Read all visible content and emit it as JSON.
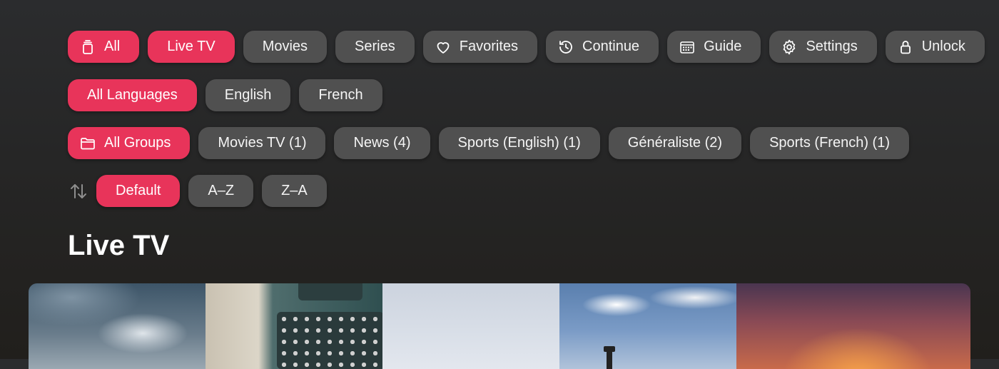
{
  "filters": {
    "type": [
      {
        "label": "All",
        "icon": "trash-icon",
        "active": true
      },
      {
        "label": "Live TV",
        "icon": "",
        "active": true
      },
      {
        "label": "Movies",
        "icon": "",
        "active": false
      },
      {
        "label": "Series",
        "icon": "",
        "active": false
      },
      {
        "label": "Favorites",
        "icon": "heart-icon",
        "active": false
      },
      {
        "label": "Continue",
        "icon": "history-icon",
        "active": false
      },
      {
        "label": "Guide",
        "icon": "calendar-icon",
        "active": false
      },
      {
        "label": "Settings",
        "icon": "gear-icon",
        "active": false
      },
      {
        "label": "Unlock",
        "icon": "lock-icon",
        "active": false
      }
    ],
    "languages": [
      {
        "label": "All Languages",
        "active": true
      },
      {
        "label": "English",
        "active": false
      },
      {
        "label": "French",
        "active": false
      }
    ],
    "groups": [
      {
        "label": "All Groups",
        "icon": "folder-icon",
        "active": true
      },
      {
        "label": "Movies TV (1)",
        "active": false
      },
      {
        "label": "News (4)",
        "active": false
      },
      {
        "label": "Sports (English) (1)",
        "active": false
      },
      {
        "label": "Généraliste (2)",
        "active": false
      },
      {
        "label": "Sports (French) (1)",
        "active": false
      }
    ],
    "sort": {
      "icon": "sort-arrows-icon",
      "options": [
        {
          "label": "Default",
          "active": true
        },
        {
          "label": "A–Z",
          "active": false
        },
        {
          "label": "Z–A",
          "active": false
        }
      ]
    }
  },
  "section": {
    "title": "Live TV"
  },
  "channels": [
    {
      "thumb": "cloudy-sky"
    },
    {
      "thumb": "typewriter"
    },
    {
      "thumb": "pale-sky"
    },
    {
      "thumb": "lamp-post-sky"
    },
    {
      "thumb": "sunset"
    }
  ],
  "colors": {
    "accent": "#e8345a",
    "chip": "#505050",
    "background": "#2b2c2e"
  }
}
